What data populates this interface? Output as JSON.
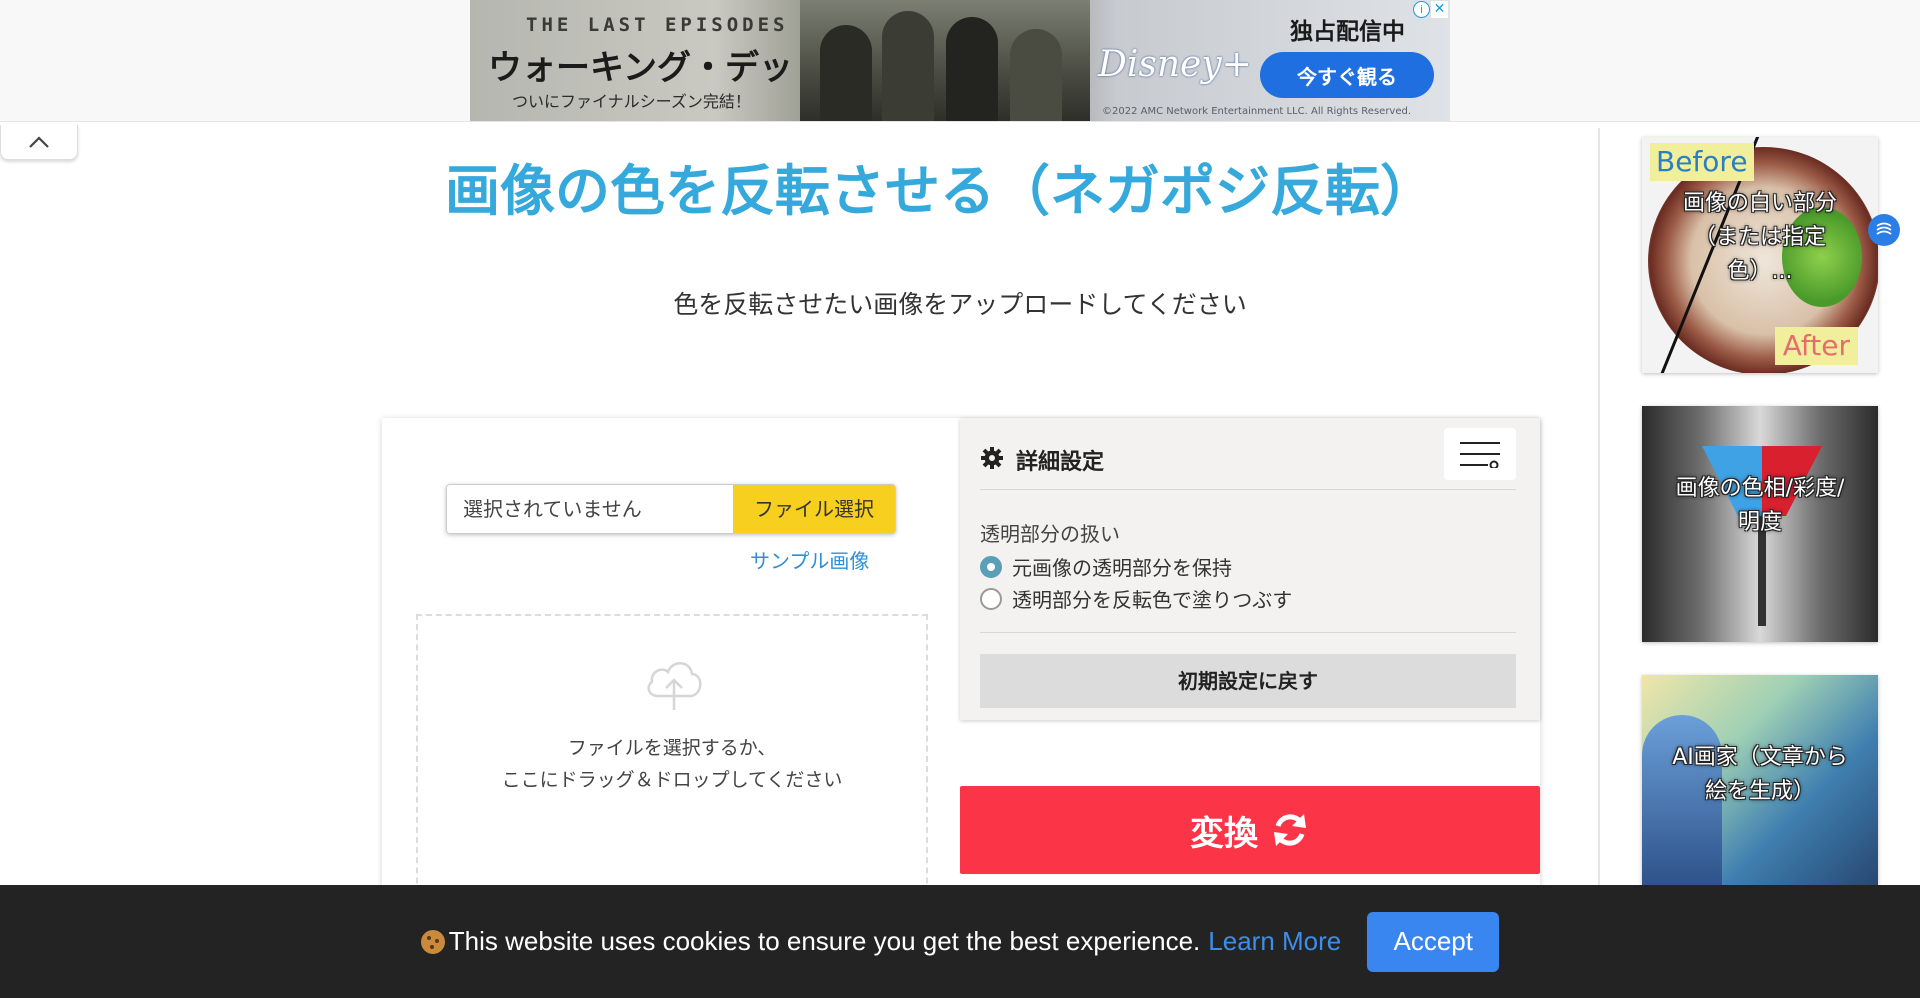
{
  "ad": {
    "line1": "THE LAST EPISODES",
    "line2": "ウォーキング・デッド",
    "line3": "ついにファイナルシーズン完結！",
    "brand": "Disney+",
    "exclusive": "独占配信中",
    "watch_label": "今すぐ観る",
    "copyright": "©2022 AMC Network Entertainment LLC. All Rights Reserved.",
    "info_glyph": "i",
    "close_glyph": "✕"
  },
  "page": {
    "title": "画像の色を反転させる（ネガポジ反転）",
    "subtitle": "色を反転させたい画像をアップロードしてください"
  },
  "upload": {
    "file_status": "選択されていません",
    "file_button": "ファイル選択",
    "sample_link": "サンプル画像",
    "drop_text_1": "ファイルを選択するか、",
    "drop_text_2": "ここにドラッグ＆ドロップしてください"
  },
  "settings": {
    "title": "詳細設定",
    "transparency_label": "透明部分の扱い",
    "options": [
      {
        "label": "元画像の透明部分を保持",
        "checked": true
      },
      {
        "label": "透明部分を反転色で塗りつぶす",
        "checked": false
      }
    ],
    "reset_label": "初期設定に戻す"
  },
  "convert": {
    "label": "変換"
  },
  "sidebar": {
    "cards": [
      {
        "caption": "画像の白い部分（または指定色）...",
        "before": "Before",
        "after": "After"
      },
      {
        "caption": "画像の色相/彩度/明度"
      },
      {
        "caption": "AI画家（文章から絵を生成）"
      }
    ]
  },
  "cookie": {
    "text": "This website uses cookies to ensure you get the best experience.",
    "learn_more": "Learn More",
    "accept": "Accept"
  },
  "colors": {
    "title": "#35a8dc",
    "file_button": "#f7cf1e",
    "convert": "#fb3448",
    "accept": "#3a86f0",
    "link": "#2f8fd4"
  },
  "icons": {
    "collapse": "chevron-up-icon",
    "gear": "gear-icon",
    "menu": "menu-lines-icon",
    "cloud": "cloud-upload-icon",
    "refresh": "refresh-icon",
    "cookie": "cookie-icon"
  }
}
